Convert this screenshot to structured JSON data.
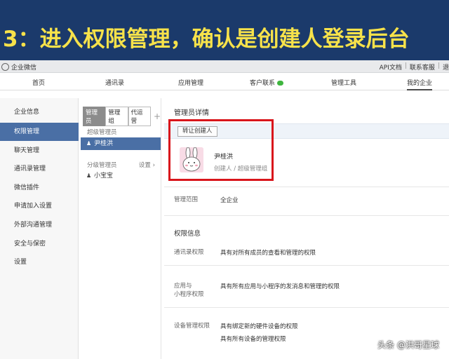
{
  "banner": {
    "text": "3：进入权限管理，确认是创建人登录后台"
  },
  "topbar": {
    "logo_text": "企业微信",
    "links": [
      "API文档",
      "联系客服",
      "退"
    ]
  },
  "nav": {
    "items": [
      "首页",
      "通讯录",
      "应用管理",
      "客户联系",
      "管理工具",
      "我的企业"
    ],
    "active": "我的企业"
  },
  "sidebar": {
    "items": [
      "企业信息",
      "权限管理",
      "聊天管理",
      "通讯录管理",
      "微信插件",
      "申请加入设置",
      "外部沟通管理",
      "安全与保密",
      "设置"
    ],
    "active": "权限管理"
  },
  "admins": {
    "tabs": [
      "管理员",
      "管理组",
      "代运营"
    ],
    "active_tab": "管理员",
    "add_symbol": "+",
    "super_label": "超级管理员",
    "super_members": [
      "尹桂洪"
    ],
    "sub_label": "分级管理员",
    "settings_label": "设置 ›",
    "sub_members": [
      "小宝宝"
    ]
  },
  "detail": {
    "title": "管理员详情",
    "transfer_button": "转让创建人",
    "name": "尹桂洪",
    "role": "创建人 / 超级管理组",
    "scope_label": "管理范围",
    "scope_value": "全企业",
    "permissions_title": "权限信息",
    "permissions": [
      {
        "label": "通讯录权限",
        "value": "具有对所有成员的查看和管理的权限"
      },
      {
        "label": "应用与\n小程序权限",
        "value": "具有所有应用与小程序的发消息和管理的权限"
      },
      {
        "label": "设备管理权限",
        "value": "具有绑定新的硬件设备的权限"
      },
      {
        "label": "",
        "value": "具有所有设备的管理权限"
      }
    ]
  },
  "watermark": "头条 @洪哥星球",
  "colors": {
    "banner_bg": "#1b3a6b",
    "banner_text": "#f7e24a",
    "active_blue": "#4a6fa5",
    "highlight": "#d9151b"
  }
}
